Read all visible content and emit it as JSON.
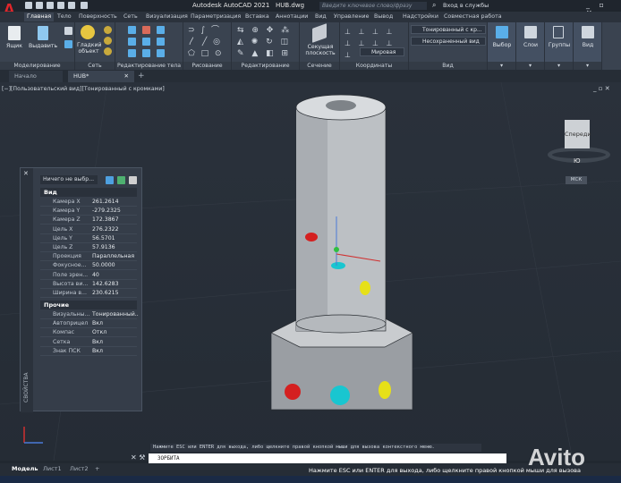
{
  "app": {
    "title": "Autodesk AutoCAD 2021",
    "file": "HUB.dwg",
    "search_placeholder": "Введите ключевое слово/фразу",
    "login": "Вход в службы"
  },
  "ribbon_tabs": [
    "Главная",
    "Тело",
    "Поверхность",
    "Сеть",
    "Визуализация",
    "Параметризация",
    "Вставка",
    "Аннотации",
    "Вид",
    "Управление",
    "Вывод",
    "Надстройки",
    "Совместная работа"
  ],
  "panels": {
    "modeling": {
      "label": "Моделирование",
      "box": "Ящик",
      "extrude": "Выдавить"
    },
    "mesh": {
      "label": "Сеть",
      "smooth": "Гладкий объект"
    },
    "solid_edit": {
      "label": "Редактирование тела"
    },
    "draw": {
      "label": "Рисование"
    },
    "modify": {
      "label": "Редактирование"
    },
    "section": {
      "label": "Сечение",
      "plane": "Секущая плоскость"
    },
    "coordinates": {
      "label": "Координаты",
      "ucs": "Мировая"
    },
    "view": {
      "label": "Вид",
      "visual_style": "Тонированный с кр...",
      "named_view": "Несохраненный вид"
    },
    "selection": {
      "label": "Выбор"
    },
    "layers": {
      "label": "Слои"
    },
    "groups": {
      "label": "Группы"
    },
    "viewp": {
      "label": "Вид"
    }
  },
  "file_tabs": [
    "Начало",
    "HUB*"
  ],
  "viewport": {
    "label": "[−][Пользовательский вид][Тонированный с кромками]",
    "viewcube_face": "Спереди",
    "compass_s": "Ю",
    "ucs_label": "МСК"
  },
  "properties": {
    "selection": "Ничего не выбр...",
    "palette_title": "СВОЙСТВА",
    "sections": [
      {
        "title": "Вид",
        "rows": [
          [
            "Камера X",
            "261.2614"
          ],
          [
            "Камера Y",
            "-279.2325"
          ],
          [
            "Камера Z",
            "172.3867"
          ],
          [
            "Цель X",
            "276.2322"
          ],
          [
            "Цель Y",
            "56.5701"
          ],
          [
            "Цель Z",
            "57.9136"
          ],
          [
            "Проекция",
            "Параллельная"
          ],
          [
            "Фокусное...",
            "50.0000"
          ],
          [
            "Поле зрен...",
            "40"
          ],
          [
            "Высота ви...",
            "142.6283"
          ],
          [
            "Ширина в...",
            "230.6215"
          ]
        ]
      },
      {
        "title": "Прочие",
        "rows": [
          [
            "Визуальны...",
            "Тонированный..."
          ],
          [
            "Автоприцел",
            "Вкл"
          ],
          [
            "Компас",
            "Откл"
          ],
          [
            "Сетка",
            "Вкл"
          ],
          [
            "Знак ПСК",
            "Вкл"
          ]
        ]
      }
    ]
  },
  "command": {
    "hint": "Нажмите ESC или ENTER для выхода, либо щелкните правой кнопкой мыши для вызова контекстного меню.",
    "input": "3ОРБИТА"
  },
  "layout_tabs": [
    "Модель",
    "Лист1",
    "Лист2"
  ],
  "status_text": "Нажмите ESC или ENTER для выхода, либо щелкните правой кнопкой мыши для вызова контекстного меню.",
  "watermark": "Avito",
  "colors": {
    "accent": "#e0262b",
    "hole_red": "#d42020",
    "hole_cyan": "#19c6d0",
    "hole_yellow": "#e6e018"
  }
}
